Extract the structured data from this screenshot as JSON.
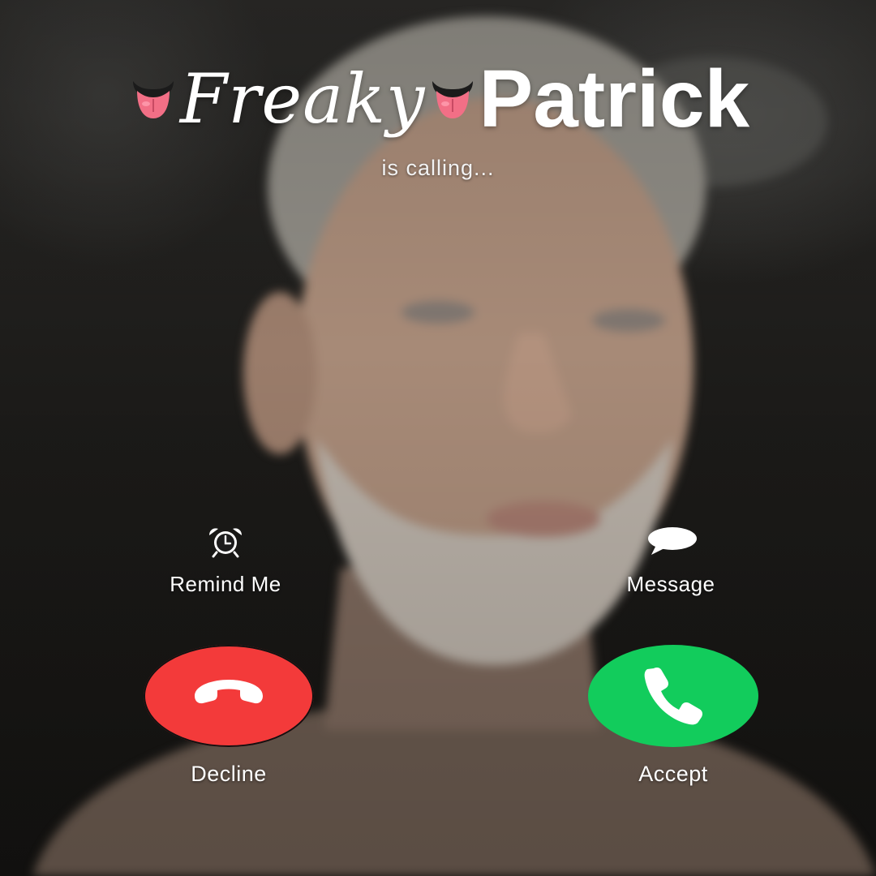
{
  "call": {
    "prefix_emoji": "👅",
    "prefix_word": "Freaky",
    "caller_name": "Patrick",
    "status": "is calling..."
  },
  "actions": {
    "remind_me": {
      "label": "Remind Me",
      "icon": "alarm-clock-icon"
    },
    "message": {
      "label": "Message",
      "icon": "speech-bubble-icon"
    },
    "decline": {
      "label": "Decline",
      "icon": "phone-hangup-icon",
      "color": "#f33a3a"
    },
    "accept": {
      "label": "Accept",
      "icon": "phone-icon",
      "color": "#12cc5c"
    }
  }
}
